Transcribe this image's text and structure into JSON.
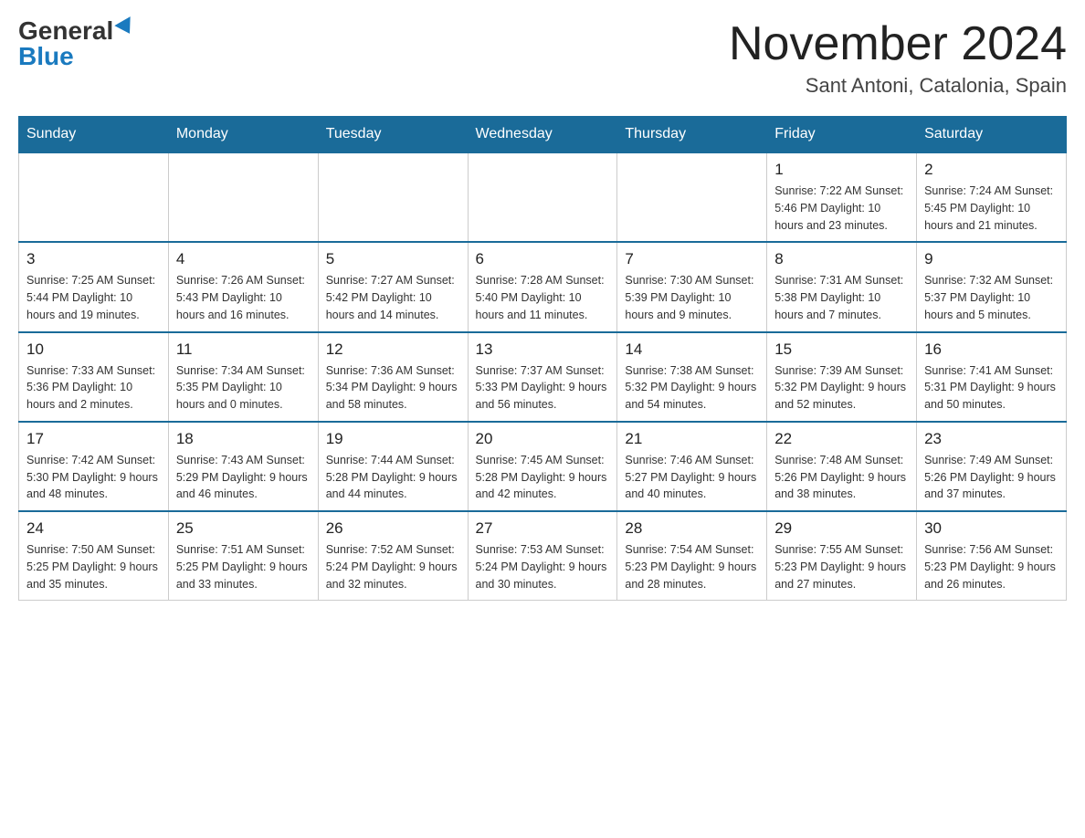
{
  "logo": {
    "general": "General",
    "blue": "Blue"
  },
  "title": "November 2024",
  "location": "Sant Antoni, Catalonia, Spain",
  "days_of_week": [
    "Sunday",
    "Monday",
    "Tuesday",
    "Wednesday",
    "Thursday",
    "Friday",
    "Saturday"
  ],
  "weeks": [
    [
      {
        "day": "",
        "info": ""
      },
      {
        "day": "",
        "info": ""
      },
      {
        "day": "",
        "info": ""
      },
      {
        "day": "",
        "info": ""
      },
      {
        "day": "",
        "info": ""
      },
      {
        "day": "1",
        "info": "Sunrise: 7:22 AM\nSunset: 5:46 PM\nDaylight: 10 hours and 23 minutes."
      },
      {
        "day": "2",
        "info": "Sunrise: 7:24 AM\nSunset: 5:45 PM\nDaylight: 10 hours and 21 minutes."
      }
    ],
    [
      {
        "day": "3",
        "info": "Sunrise: 7:25 AM\nSunset: 5:44 PM\nDaylight: 10 hours and 19 minutes."
      },
      {
        "day": "4",
        "info": "Sunrise: 7:26 AM\nSunset: 5:43 PM\nDaylight: 10 hours and 16 minutes."
      },
      {
        "day": "5",
        "info": "Sunrise: 7:27 AM\nSunset: 5:42 PM\nDaylight: 10 hours and 14 minutes."
      },
      {
        "day": "6",
        "info": "Sunrise: 7:28 AM\nSunset: 5:40 PM\nDaylight: 10 hours and 11 minutes."
      },
      {
        "day": "7",
        "info": "Sunrise: 7:30 AM\nSunset: 5:39 PM\nDaylight: 10 hours and 9 minutes."
      },
      {
        "day": "8",
        "info": "Sunrise: 7:31 AM\nSunset: 5:38 PM\nDaylight: 10 hours and 7 minutes."
      },
      {
        "day": "9",
        "info": "Sunrise: 7:32 AM\nSunset: 5:37 PM\nDaylight: 10 hours and 5 minutes."
      }
    ],
    [
      {
        "day": "10",
        "info": "Sunrise: 7:33 AM\nSunset: 5:36 PM\nDaylight: 10 hours and 2 minutes."
      },
      {
        "day": "11",
        "info": "Sunrise: 7:34 AM\nSunset: 5:35 PM\nDaylight: 10 hours and 0 minutes."
      },
      {
        "day": "12",
        "info": "Sunrise: 7:36 AM\nSunset: 5:34 PM\nDaylight: 9 hours and 58 minutes."
      },
      {
        "day": "13",
        "info": "Sunrise: 7:37 AM\nSunset: 5:33 PM\nDaylight: 9 hours and 56 minutes."
      },
      {
        "day": "14",
        "info": "Sunrise: 7:38 AM\nSunset: 5:32 PM\nDaylight: 9 hours and 54 minutes."
      },
      {
        "day": "15",
        "info": "Sunrise: 7:39 AM\nSunset: 5:32 PM\nDaylight: 9 hours and 52 minutes."
      },
      {
        "day": "16",
        "info": "Sunrise: 7:41 AM\nSunset: 5:31 PM\nDaylight: 9 hours and 50 minutes."
      }
    ],
    [
      {
        "day": "17",
        "info": "Sunrise: 7:42 AM\nSunset: 5:30 PM\nDaylight: 9 hours and 48 minutes."
      },
      {
        "day": "18",
        "info": "Sunrise: 7:43 AM\nSunset: 5:29 PM\nDaylight: 9 hours and 46 minutes."
      },
      {
        "day": "19",
        "info": "Sunrise: 7:44 AM\nSunset: 5:28 PM\nDaylight: 9 hours and 44 minutes."
      },
      {
        "day": "20",
        "info": "Sunrise: 7:45 AM\nSunset: 5:28 PM\nDaylight: 9 hours and 42 minutes."
      },
      {
        "day": "21",
        "info": "Sunrise: 7:46 AM\nSunset: 5:27 PM\nDaylight: 9 hours and 40 minutes."
      },
      {
        "day": "22",
        "info": "Sunrise: 7:48 AM\nSunset: 5:26 PM\nDaylight: 9 hours and 38 minutes."
      },
      {
        "day": "23",
        "info": "Sunrise: 7:49 AM\nSunset: 5:26 PM\nDaylight: 9 hours and 37 minutes."
      }
    ],
    [
      {
        "day": "24",
        "info": "Sunrise: 7:50 AM\nSunset: 5:25 PM\nDaylight: 9 hours and 35 minutes."
      },
      {
        "day": "25",
        "info": "Sunrise: 7:51 AM\nSunset: 5:25 PM\nDaylight: 9 hours and 33 minutes."
      },
      {
        "day": "26",
        "info": "Sunrise: 7:52 AM\nSunset: 5:24 PM\nDaylight: 9 hours and 32 minutes."
      },
      {
        "day": "27",
        "info": "Sunrise: 7:53 AM\nSunset: 5:24 PM\nDaylight: 9 hours and 30 minutes."
      },
      {
        "day": "28",
        "info": "Sunrise: 7:54 AM\nSunset: 5:23 PM\nDaylight: 9 hours and 28 minutes."
      },
      {
        "day": "29",
        "info": "Sunrise: 7:55 AM\nSunset: 5:23 PM\nDaylight: 9 hours and 27 minutes."
      },
      {
        "day": "30",
        "info": "Sunrise: 7:56 AM\nSunset: 5:23 PM\nDaylight: 9 hours and 26 minutes."
      }
    ]
  ]
}
